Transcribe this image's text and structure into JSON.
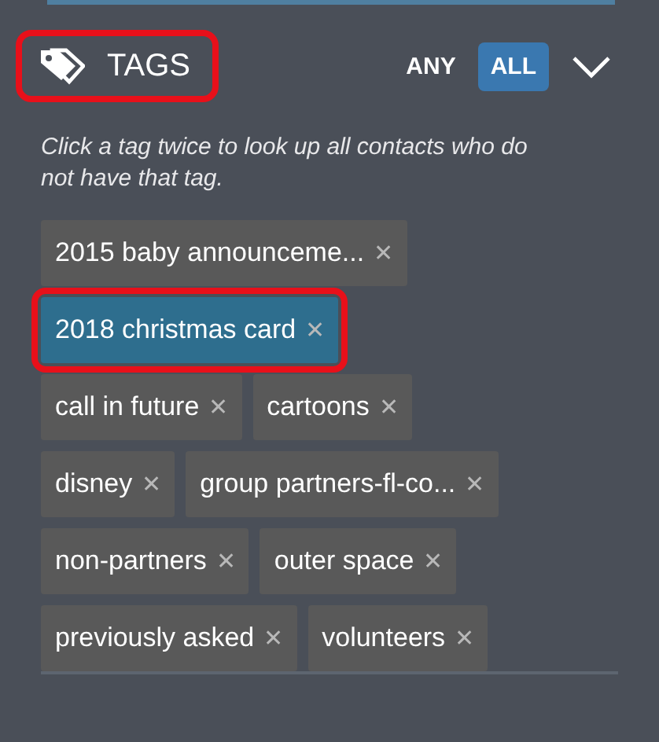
{
  "header": {
    "title": "TAGS",
    "highlighted": true,
    "match_modes": [
      {
        "label": "ANY",
        "selected": false
      },
      {
        "label": "ALL",
        "selected": true
      }
    ],
    "expanded": false
  },
  "hint": "Click a tag twice to look up all contacts who do not have that tag.",
  "tag_rows": [
    [
      {
        "label": "2015 baby announceme...",
        "selected": false,
        "highlighted": false,
        "remove": "✕"
      }
    ],
    [
      {
        "label": "2018 christmas card",
        "selected": true,
        "highlighted": true,
        "remove": "✕"
      }
    ],
    [
      {
        "label": "call in future",
        "selected": false,
        "highlighted": false,
        "remove": "✕"
      },
      {
        "label": "cartoons",
        "selected": false,
        "highlighted": false,
        "remove": "✕"
      }
    ],
    [
      {
        "label": "disney",
        "selected": false,
        "highlighted": false,
        "remove": "✕"
      },
      {
        "label": "group partners-fl-co...",
        "selected": false,
        "highlighted": false,
        "remove": "✕"
      }
    ],
    [
      {
        "label": "non-partners",
        "selected": false,
        "highlighted": false,
        "remove": "✕"
      },
      {
        "label": "outer space",
        "selected": false,
        "highlighted": false,
        "remove": "✕"
      }
    ],
    [
      {
        "label": "previously asked",
        "selected": false,
        "highlighted": false,
        "remove": "✕"
      },
      {
        "label": "volunteers",
        "selected": false,
        "highlighted": false,
        "remove": "✕"
      }
    ]
  ]
}
